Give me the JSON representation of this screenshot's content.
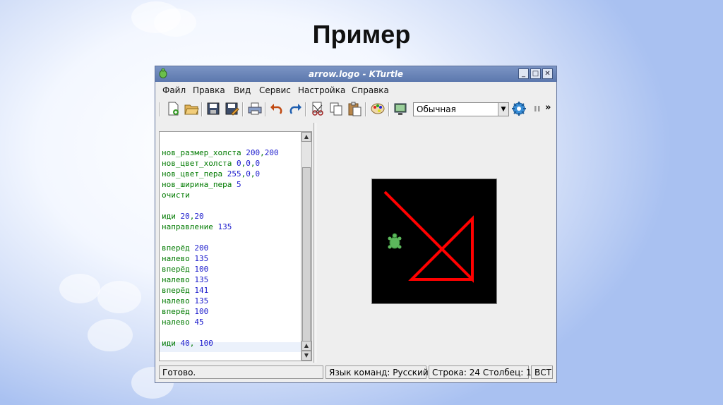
{
  "slide": {
    "title": "Пример"
  },
  "window": {
    "title": "arrow.logo - KTurtle"
  },
  "window_buttons": {
    "minimize": "_",
    "maximize": "□",
    "close": "✕"
  },
  "menu": [
    "Файл",
    "Правка",
    "Вид",
    "Сервис",
    "Настройка",
    "Справка"
  ],
  "toolbar": {
    "buttons": [
      "new-file-icon",
      "open-folder-icon",
      "save-icon",
      "save-as-icon",
      "print-icon",
      "undo-icon",
      "redo-icon",
      "cut-icon",
      "copy-icon",
      "paste-icon",
      "color-picker-icon",
      "fullscreen-icon",
      "run-icon",
      "pause-icon"
    ],
    "speed_value": "Обычная",
    "overflow": "»"
  },
  "code_lines": [
    [],
    [
      {
        "t": "нов_размер_холста ",
        "c": "kw"
      },
      {
        "t": "200",
        "c": "num"
      },
      {
        "t": ",",
        "c": "kw"
      },
      {
        "t": "200",
        "c": "num"
      }
    ],
    [
      {
        "t": "нов_цвет_холста ",
        "c": "kw"
      },
      {
        "t": "0",
        "c": "num"
      },
      {
        "t": ",",
        "c": "kw"
      },
      {
        "t": "0",
        "c": "num"
      },
      {
        "t": ",",
        "c": "kw"
      },
      {
        "t": "0",
        "c": "num"
      }
    ],
    [
      {
        "t": "нов_цвет_пера ",
        "c": "kw"
      },
      {
        "t": "255",
        "c": "num"
      },
      {
        "t": ",",
        "c": "kw"
      },
      {
        "t": "0",
        "c": "num"
      },
      {
        "t": ",",
        "c": "kw"
      },
      {
        "t": "0",
        "c": "num"
      }
    ],
    [
      {
        "t": "нов_ширина_пера ",
        "c": "kw"
      },
      {
        "t": "5",
        "c": "num"
      }
    ],
    [
      {
        "t": "очисти",
        "c": "kw"
      }
    ],
    [],
    [
      {
        "t": "иди ",
        "c": "kw"
      },
      {
        "t": "20",
        "c": "num"
      },
      {
        "t": ",",
        "c": "kw"
      },
      {
        "t": "20",
        "c": "num"
      }
    ],
    [
      {
        "t": "направление ",
        "c": "kw"
      },
      {
        "t": "135",
        "c": "num"
      }
    ],
    [],
    [
      {
        "t": "вперёд ",
        "c": "kw"
      },
      {
        "t": "200",
        "c": "num"
      }
    ],
    [
      {
        "t": "налево ",
        "c": "kw"
      },
      {
        "t": "135",
        "c": "num"
      }
    ],
    [
      {
        "t": "вперёд ",
        "c": "kw"
      },
      {
        "t": "100",
        "c": "num"
      }
    ],
    [
      {
        "t": "налево ",
        "c": "kw"
      },
      {
        "t": "135",
        "c": "num"
      }
    ],
    [
      {
        "t": "вперёд ",
        "c": "kw"
      },
      {
        "t": "141",
        "c": "num"
      }
    ],
    [
      {
        "t": "налево ",
        "c": "kw"
      },
      {
        "t": "135",
        "c": "num"
      }
    ],
    [
      {
        "t": "вперёд ",
        "c": "kw"
      },
      {
        "t": "100",
        "c": "num"
      }
    ],
    [
      {
        "t": "налево ",
        "c": "kw"
      },
      {
        "t": "45",
        "c": "num"
      }
    ],
    [],
    [
      {
        "t": "иди ",
        "c": "kw"
      },
      {
        "t": "40",
        "c": "num"
      },
      {
        "t": ", ",
        "c": "kw"
      },
      {
        "t": "100",
        "c": "num"
      }
    ]
  ],
  "colors": {
    "canvas": "#000000",
    "pen": "#ff0000",
    "turtle": "#5cb85c",
    "keyword": "#007a00",
    "number": "#1a1acc"
  },
  "statusbar": {
    "status": "Готово.",
    "language": "Язык команд: Русский",
    "position": "Строка: 24 Столбец: 1",
    "mode": "ВСТ"
  }
}
